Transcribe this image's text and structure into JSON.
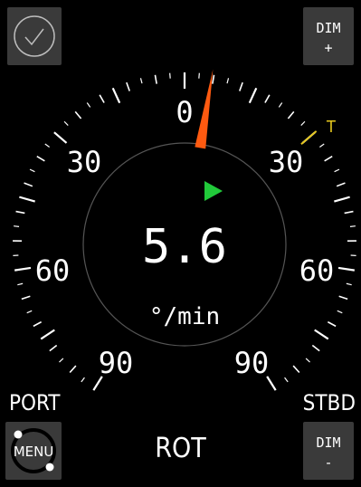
{
  "gauge": {
    "value": "5.6",
    "unit": "°/min",
    "rate_deg_per_min": 5.6,
    "scale_labels": [
      "0",
      "30",
      "30",
      "60",
      "60",
      "90",
      "90"
    ],
    "target_marker": "T"
  },
  "labels": {
    "port": "PORT",
    "stbd": "STBD",
    "mode": "ROT"
  },
  "buttons": {
    "ok_icon": "checkmark-circle-icon",
    "dim_plus_top": "DIM",
    "dim_plus_bottom": "+",
    "dim_minus_top": "DIM",
    "dim_minus_bottom": "-",
    "menu": "MENU"
  },
  "colors": {
    "background": "#000000",
    "needle": "#ff5a10",
    "indicator": "#21c93a",
    "target": "#e6c81e"
  }
}
